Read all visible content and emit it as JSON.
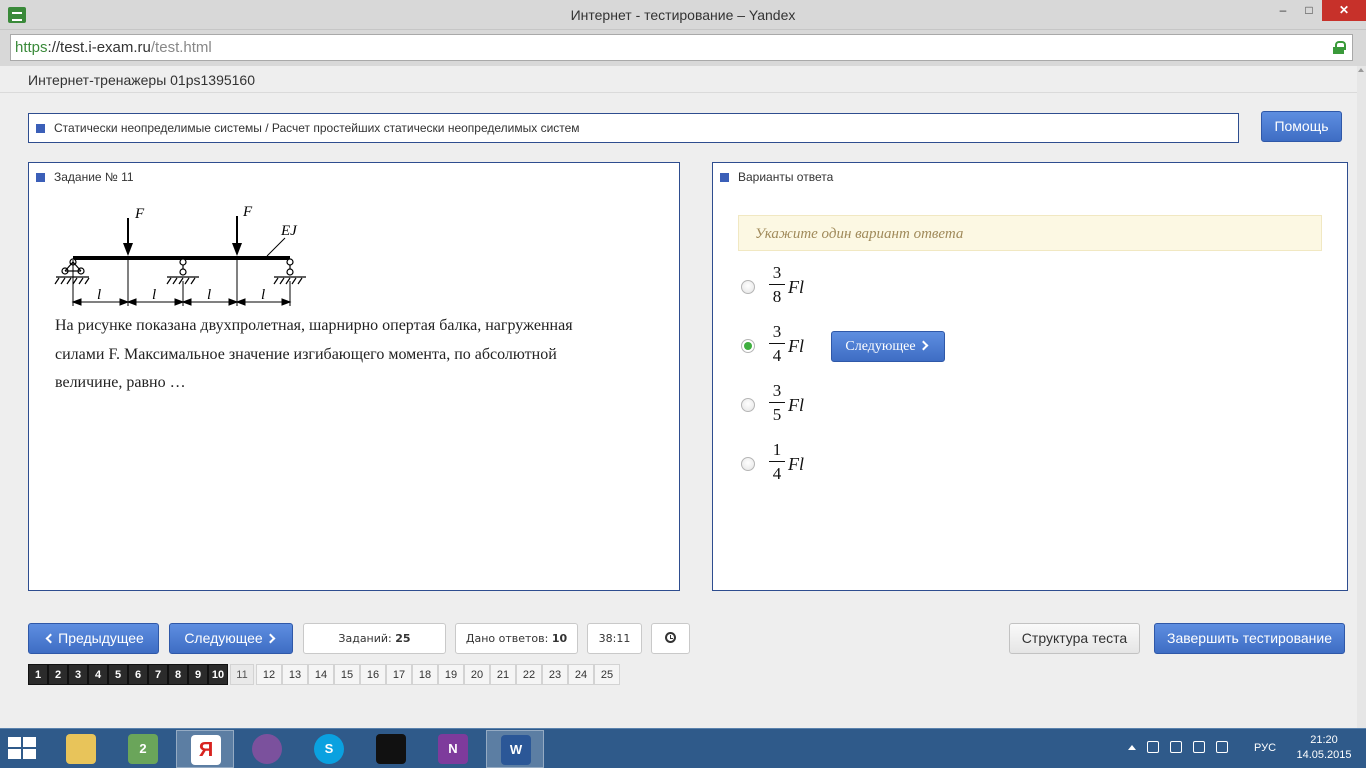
{
  "window": {
    "title": "Интернет - тестирование – Yandex",
    "minimize": "–",
    "maximize": "□",
    "close": "✕"
  },
  "address": {
    "scheme": "https",
    "host": "://test.i-exam.ru",
    "path": "/test.html"
  },
  "header": {
    "title": "Интернет-тренажеры 01ps1395160"
  },
  "topic": {
    "text": "Статически неопределимые системы / Расчет простейших статически неопределимых систем"
  },
  "help_button": "Помощь",
  "task": {
    "title": "Задание № 11",
    "figure": {
      "force_label": "F",
      "stiffness_label": "EJ",
      "span_label": "l"
    },
    "text": "На рисунке показана двухпролетная, шарнирно опертая балка, нагруженная силами F. Максимальное значение изгибающего момента, по абсолютной величине, равно …"
  },
  "answers": {
    "title": "Варианты ответа",
    "hint": "Укажите один вариант ответа",
    "options": [
      {
        "num": "3",
        "den": "8",
        "suffix": "Fl",
        "selected": false
      },
      {
        "num": "3",
        "den": "4",
        "suffix": "Fl",
        "selected": true
      },
      {
        "num": "3",
        "den": "5",
        "suffix": "Fl",
        "selected": false
      },
      {
        "num": "1",
        "den": "4",
        "suffix": "Fl",
        "selected": false
      }
    ],
    "next_label": "Следующее"
  },
  "footer": {
    "prev_label": "Предыдущее",
    "next_label": "Следующее",
    "tasks_label": "Заданий:",
    "tasks_count": "25",
    "answered_label": "Дано ответов:",
    "answered_count": "10",
    "timer": "38:11",
    "structure_label": "Структура теста",
    "finish_label": "Завершить тестирование"
  },
  "pager": {
    "done": [
      "1",
      "2",
      "3",
      "4",
      "5",
      "6",
      "7",
      "8",
      "9",
      "10"
    ],
    "current": "11",
    "rest": [
      "12",
      "13",
      "14",
      "15",
      "16",
      "17",
      "18",
      "19",
      "20",
      "21",
      "22",
      "23",
      "24",
      "25"
    ]
  },
  "taskbar": {
    "apps": [
      "file-explorer",
      "maps",
      "yandex-browser",
      "viber",
      "skype",
      "galaxy",
      "onenote",
      "word"
    ],
    "maps_badge": "2",
    "language": "РУС",
    "time": "21:20",
    "date": "14.05.2015"
  },
  "colors": {
    "accent_blue": "#3e6dc4",
    "panel_border": "#2e4d8f",
    "hint_bg": "#fcf8e3",
    "selected_radio": "#3fae3f",
    "taskbar": "#2f5a8a"
  }
}
